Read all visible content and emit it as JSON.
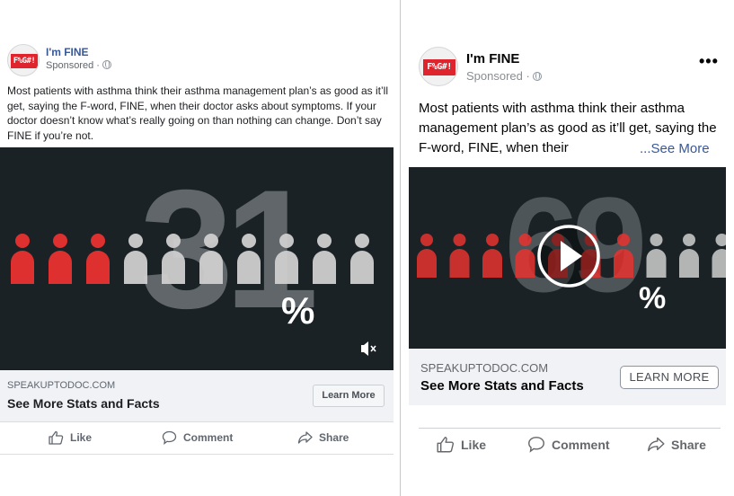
{
  "left_ad": {
    "page_name": "I'm FINE",
    "logo_text": "F%G#!",
    "sponsored": "Sponsored ·",
    "post_text": "Most patients with asthma think their asthma management plan’s as good as it’ll get, saying the F-word, FINE, when their doctor asks about symptoms. If your doctor doesn’t know what’s really going on than nothing can change. Don’t say FINE if you’re not.",
    "video": {
      "stat_number": "31",
      "stat_symbol": "%",
      "highlighted_people": 3,
      "total_people": 10
    },
    "cta": {
      "domain": "SPEAKUPTODOC.COM",
      "headline": "See More Stats and Facts",
      "button": "Learn More"
    },
    "actions": {
      "like": "Like",
      "comment": "Comment",
      "share": "Share"
    }
  },
  "right_ad": {
    "page_name": "I'm FINE",
    "logo_text": "F%G#!",
    "sponsored": "Sponsored ·",
    "post_text": "Most patients with asthma think their asthma management plan’s as good as it’ll get, saying the F-word, FINE, when their",
    "see_more": "...See More",
    "more_options": "•••",
    "video": {
      "stat_number": "69",
      "stat_symbol": "%",
      "highlighted_people": 7,
      "total_people": 10
    },
    "cta": {
      "domain": "SPEAKUPTODOC.COM",
      "headline": "See More Stats and Facts",
      "button": "LEARN MORE"
    },
    "actions": {
      "like": "Like",
      "comment": "Comment",
      "share": "Share"
    }
  },
  "colors": {
    "video_bg": "#1a2226",
    "highlight_red": "#e8322f",
    "person_gray": "#cfcfcf",
    "link_blue": "#385898"
  }
}
